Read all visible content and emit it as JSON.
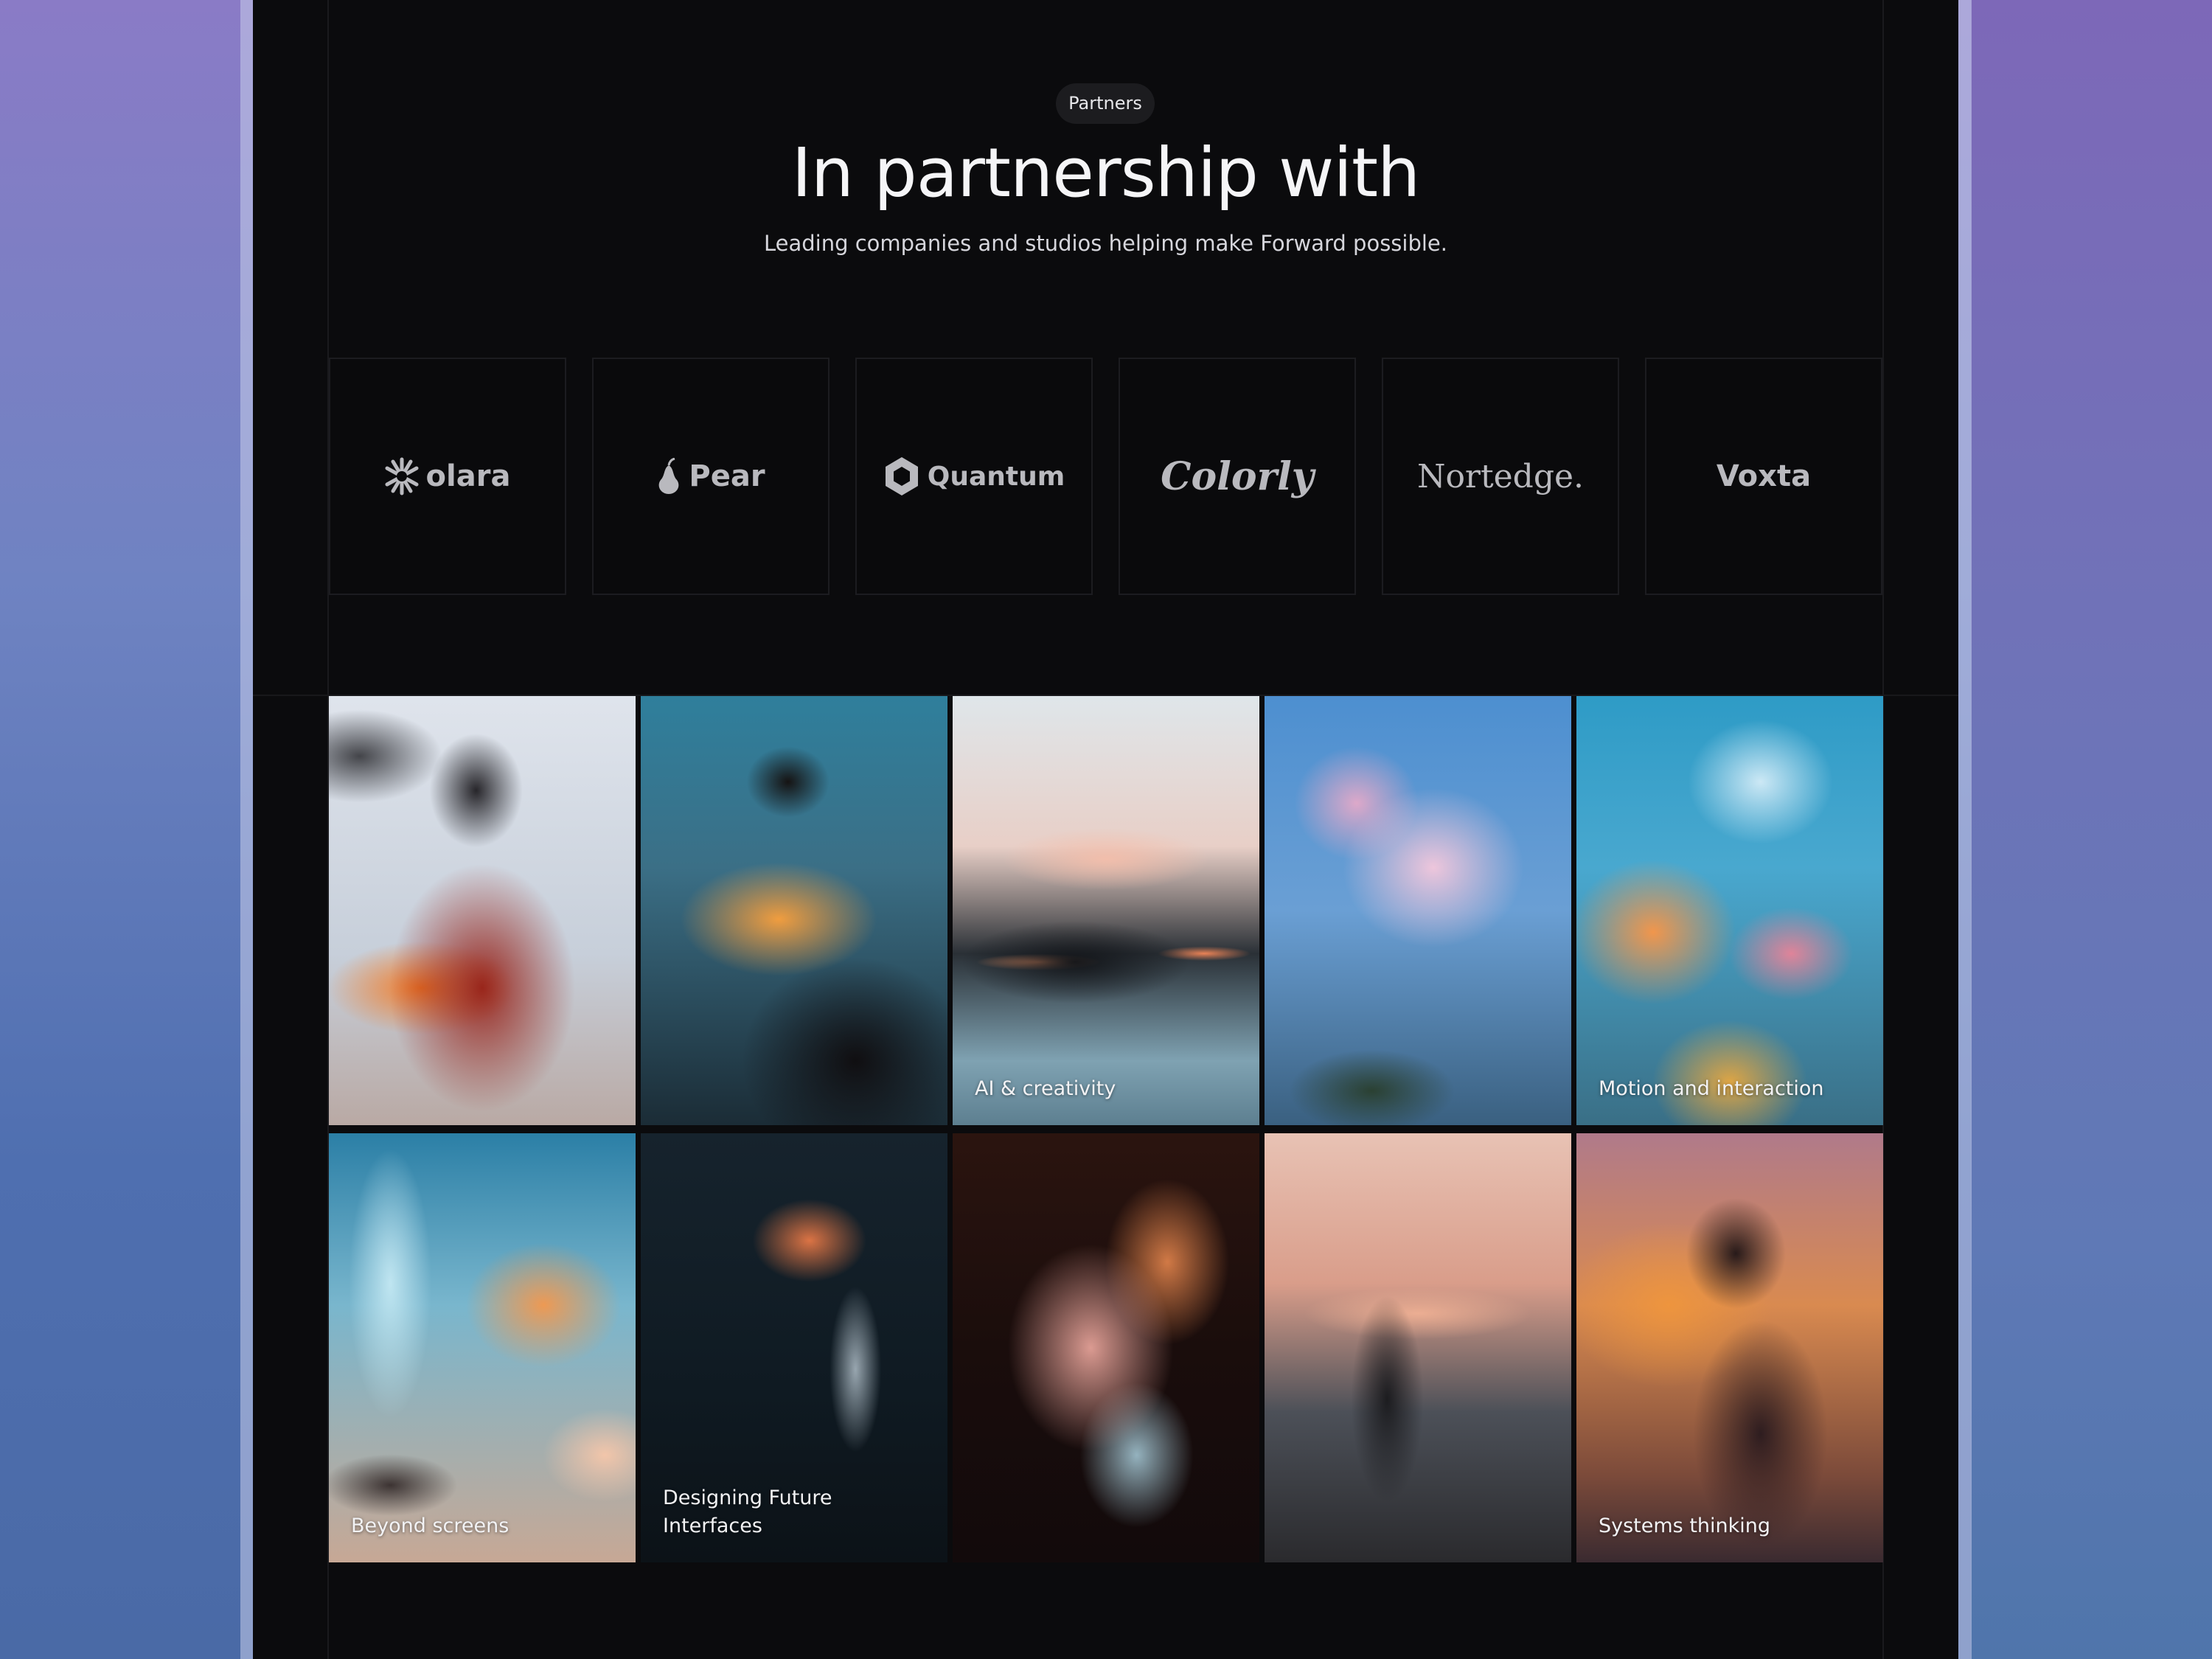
{
  "section": {
    "badge": "Partners",
    "title": "In partnership with",
    "subtitle": "Leading companies and studios helping make Forward possible."
  },
  "partners": [
    {
      "name": "olara",
      "icon": "sunburst-icon"
    },
    {
      "name": "Pear",
      "icon": "pear-icon"
    },
    {
      "name": "Quantum",
      "icon": "hexagon-icon"
    },
    {
      "name": "Colorly",
      "icon": ""
    },
    {
      "name": "Nortedge.",
      "icon": ""
    },
    {
      "name": "Voxta",
      "icon": ""
    }
  ],
  "gallery": [
    {
      "caption": "",
      "image": "blurred woman with flowing hair"
    },
    {
      "caption": "",
      "image": "blurred figure with orange light"
    },
    {
      "caption": "AI & creativity",
      "image": "blurred sunset landscape"
    },
    {
      "caption": "",
      "image": "blurred pink flower"
    },
    {
      "caption": "Motion and interaction",
      "image": "blurred colorful petals"
    },
    {
      "caption": "Beyond screens",
      "image": "blurred blue and orange scene"
    },
    {
      "caption": "Designing Future Interfaces",
      "image": "blurred orange flower on dark"
    },
    {
      "caption": "",
      "image": "blurred face with light streaks"
    },
    {
      "caption": "",
      "image": "blurred silhouette at dusk"
    },
    {
      "caption": "Systems thinking",
      "image": "silhouette with orange glow"
    }
  ]
}
